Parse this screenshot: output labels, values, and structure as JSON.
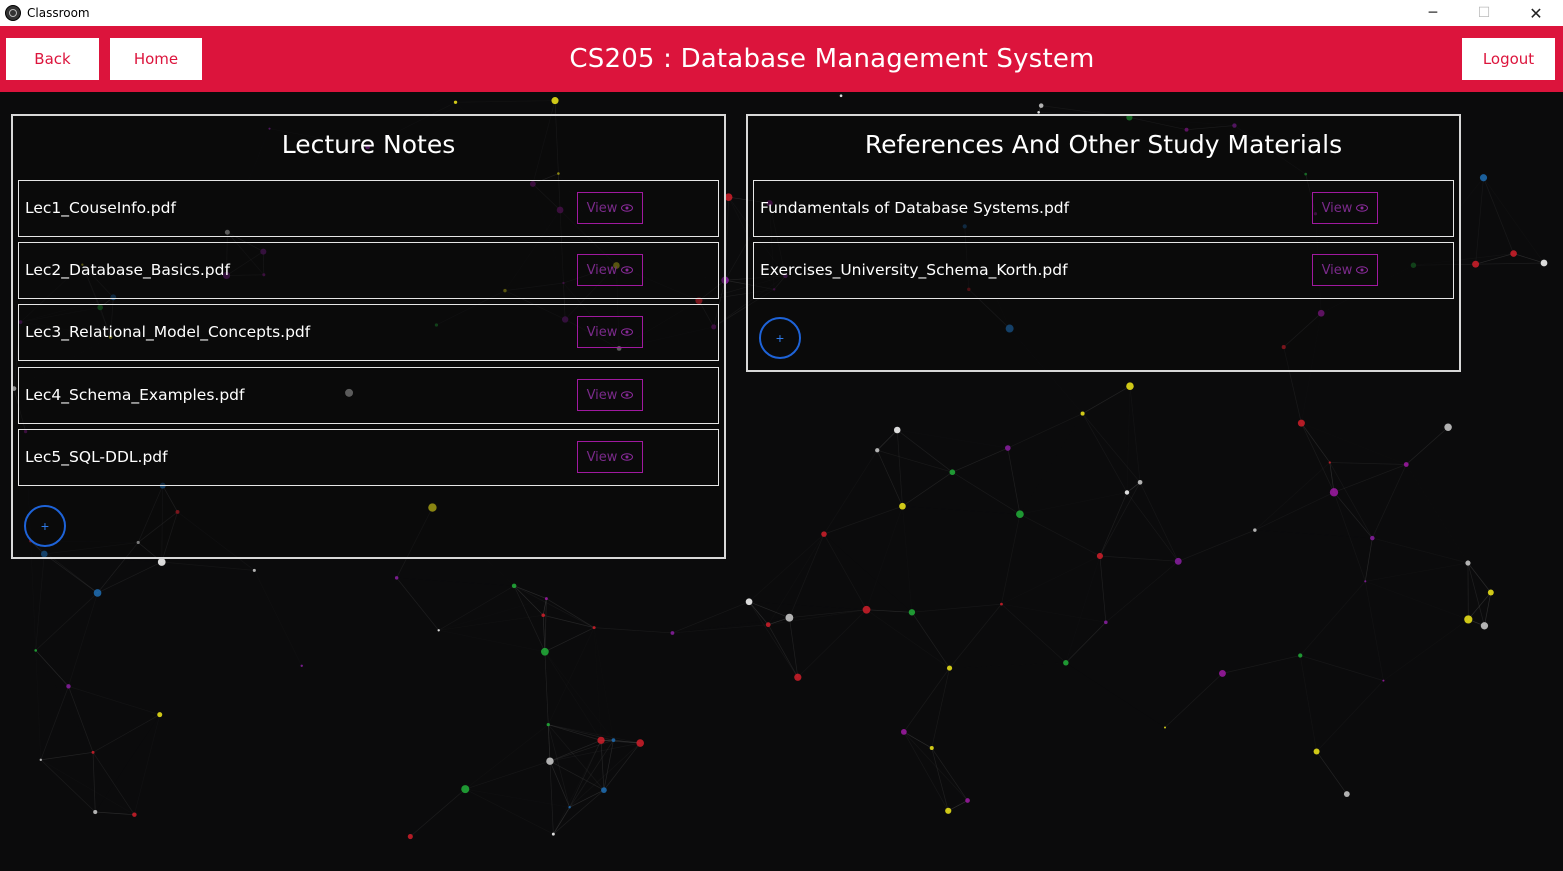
{
  "window": {
    "title": "Classroom"
  },
  "header": {
    "title": "CS205 : Database Management System",
    "back_label": "Back",
    "home_label": "Home",
    "logout_label": "Logout"
  },
  "lecture_notes": {
    "heading": "Lecture Notes",
    "items": [
      {
        "name": "Lec1_CouseInfo.pdf",
        "view_label": "View"
      },
      {
        "name": "Lec2_Database_Basics.pdf",
        "view_label": "View"
      },
      {
        "name": "Lec3_Relational_Model_Concepts.pdf",
        "view_label": "View"
      },
      {
        "name": "Lec4_Schema_Examples.pdf",
        "view_label": "View"
      },
      {
        "name": "Lec5_SQL-DDL.pdf",
        "view_label": "View"
      }
    ],
    "add_label": "+"
  },
  "references": {
    "heading": "References And Other Study Materials",
    "items": [
      {
        "name": "Fundamentals of Database Systems.pdf",
        "view_label": "View"
      },
      {
        "name": "Exercises_University_Schema_Korth.pdf",
        "view_label": "View"
      }
    ],
    "add_label": "+"
  },
  "colors": {
    "header_bg": "#dc143c",
    "background": "#0b0b0c",
    "view_border": "#a0199f",
    "add_border": "#1e63d8"
  },
  "icons": {
    "app": "classroom-app-icon",
    "view": "eye-icon",
    "add": "plus-icon"
  }
}
